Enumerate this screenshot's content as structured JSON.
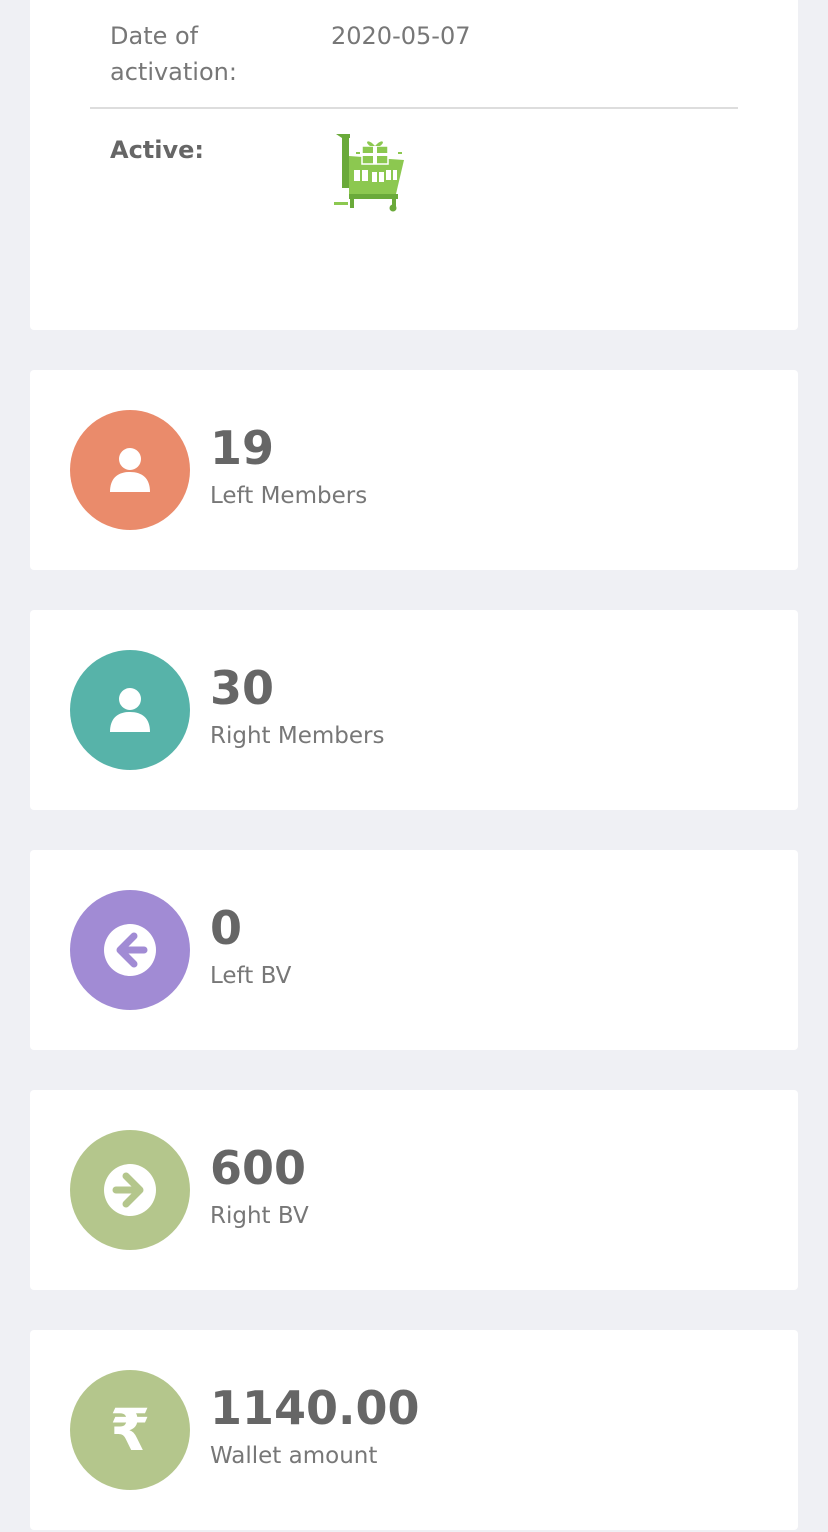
{
  "info": {
    "date_label": "Date of activation:",
    "date_value": "2020-05-07",
    "active_label": "Active:",
    "active_icon": "shopping-cart-gift-icon"
  },
  "stats": [
    {
      "value": "19",
      "label": "Left Members",
      "icon": "user-icon",
      "color": "#ea8b6b"
    },
    {
      "value": "30",
      "label": "Right Members",
      "icon": "user-icon",
      "color": "#57b3a9"
    },
    {
      "value": "0",
      "label": "Left BV",
      "icon": "arrow-left-circle-icon",
      "color": "#a18bd4"
    },
    {
      "value": "600",
      "label": "Right BV",
      "icon": "arrow-right-circle-icon",
      "color": "#b4c68c"
    },
    {
      "value": "1140.00",
      "label": "Wallet amount",
      "icon": "rupee-icon",
      "color": "#b4c68c",
      "glyph": "₹"
    }
  ]
}
